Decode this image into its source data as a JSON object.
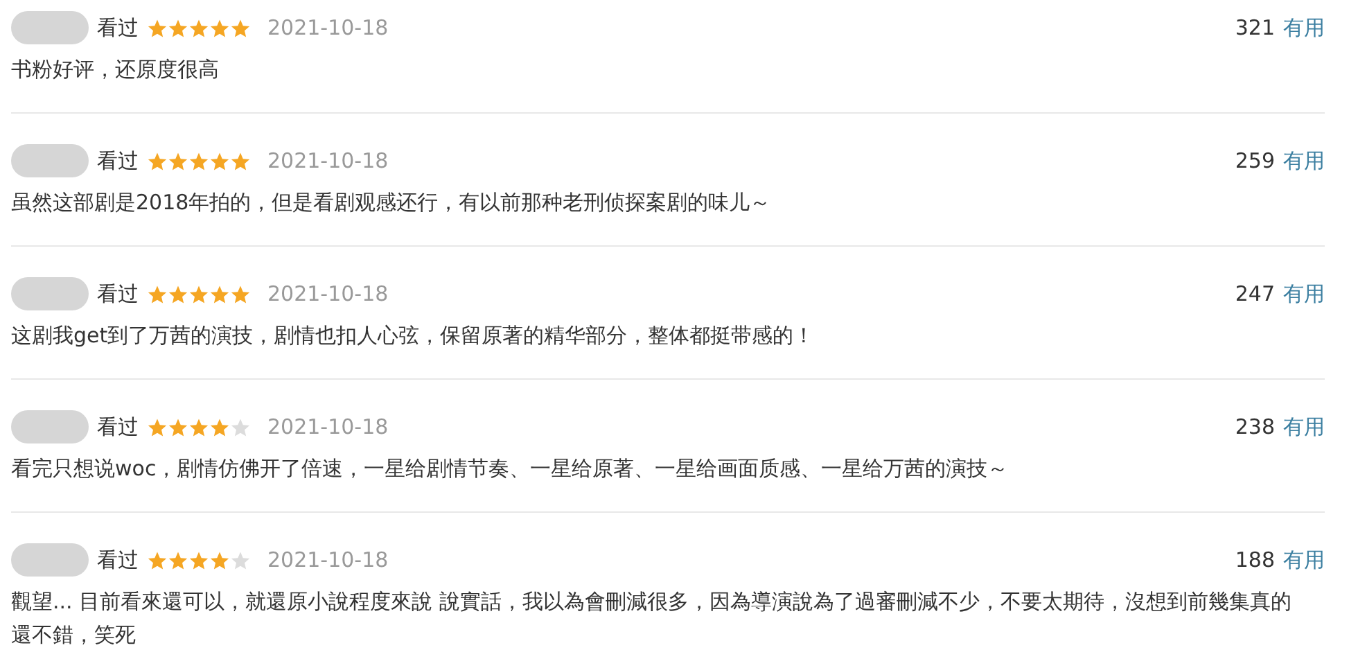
{
  "reviews": [
    {
      "status": "看过",
      "stars": 5,
      "date": "2021-10-18",
      "votes": "321",
      "useful": "有用",
      "text": "书粉好评，还原度很高"
    },
    {
      "status": "看过",
      "stars": 5,
      "date": "2021-10-18",
      "votes": "259",
      "useful": "有用",
      "text": "虽然这部剧是2018年拍的，但是看剧观感还行，有以前那种老刑侦探案剧的味儿～"
    },
    {
      "status": "看过",
      "stars": 5,
      "date": "2021-10-18",
      "votes": "247",
      "useful": "有用",
      "text": "这剧我get到了万茜的演技，剧情也扣人心弦，保留原著的精华部分，整体都挺带感的！"
    },
    {
      "status": "看过",
      "stars": 4,
      "date": "2021-10-18",
      "votes": "238",
      "useful": "有用",
      "text": "看完只想说woc，剧情仿佛开了倍速，一星给剧情节奏、一星给原著、一星给画面质感、一星给万茜的演技～"
    },
    {
      "status": "看过",
      "stars": 4,
      "date": "2021-10-18",
      "votes": "188",
      "useful": "有用",
      "text": "觀望... 目前看來還可以，就還原小說程度來說 說實話，我以為會刪減很多，因為導演說為了過審刪減不少，不要太期待，沒想到前幾集真的還不錯，笑死"
    }
  ]
}
